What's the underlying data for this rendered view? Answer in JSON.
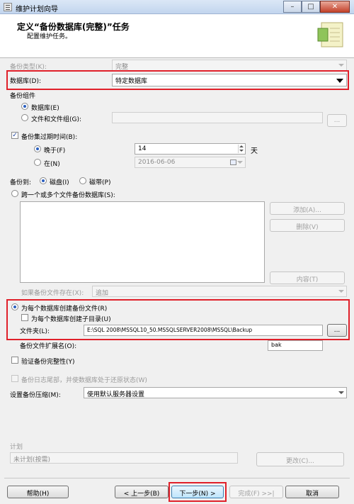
{
  "window": {
    "title": "维护计划向导"
  },
  "header": {
    "title": "定义“备份数据库(完整)”任务",
    "subtitle": "配置维护任务。"
  },
  "backup_type": {
    "label": "备份类型(K):",
    "value": "完整"
  },
  "database": {
    "label": "数据库(D):",
    "value": "特定数据库"
  },
  "backup_component": {
    "label": "备份组件",
    "database_option": "数据库(E)",
    "files_option": "文件和文件组(G):"
  },
  "expiry": {
    "label": "备份集过期时间(B):",
    "after_label": "晚于(F)",
    "after_value": "14",
    "after_unit": "天",
    "on_label": "在(N)",
    "on_value": "2016-06-06"
  },
  "backup_to": {
    "label": "备份到:",
    "disk": "磁盘(I)",
    "tape": "磁带(P)"
  },
  "span_files": {
    "label": "跨一个或多个文件备份数据库(S):",
    "add_button": "添加(A)...",
    "remove_button": "删除(V)",
    "contents_button": "内容(T)",
    "if_exists_label": "如果备份文件存在(X):",
    "if_exists_value": "追加"
  },
  "per_db": {
    "label": "为每个数据库创建备份文件(R)",
    "subdir_label": "为每个数据库创建子目录(U)",
    "folder_label": "文件夹(L):",
    "folder_value": "E:\\SQL 2008\\MSSQL10_50.MSSQLSERVER2008\\MSSQL\\Backup",
    "browse_button": "...",
    "extension_label": "备份文件扩展名(O):",
    "extension_value": "bak"
  },
  "verify": {
    "label": "验证备份完整性(Y)"
  },
  "log_tail": {
    "label": "备份日志尾部，并使数据库处于还原状态(W)"
  },
  "compression": {
    "label": "设置备份压缩(M):",
    "value": "使用默认服务器设置"
  },
  "schedule": {
    "label": "计划",
    "value": "未计划(按需)",
    "change_button": "更改(C)..."
  },
  "footer": {
    "help": "帮助(H)",
    "back": "< 上一步(B)",
    "next": "下一步(N) >",
    "finish": "完成(F) >>|",
    "cancel": "取消"
  },
  "colors": {
    "highlight": "#e0202a",
    "dialog_bg": "#f0f0f0",
    "accent": "#2a5fc0"
  }
}
